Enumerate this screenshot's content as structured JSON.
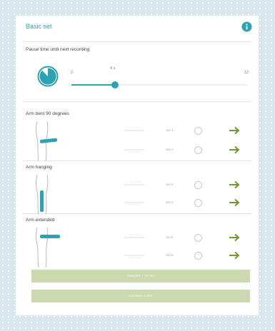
{
  "header": {
    "title": "Basic set"
  },
  "pause": {
    "label": "Pause time until next recording",
    "min_label": "2",
    "value_label": "4 s",
    "max_label": "12",
    "value": 4,
    "min": 2,
    "max": 12
  },
  "sections": [
    {
      "label": "Arm bent 90 degrees",
      "sets": [
        "Set 1",
        "Set 2"
      ]
    },
    {
      "label": "Arm hanging",
      "sets": [
        "Set 3",
        "Set 4"
      ]
    },
    {
      "label": "Arm extended",
      "sets": [
        "Set 5",
        "Set 6"
      ]
    }
  ],
  "buttons": {
    "primary": "Complete 1 Mit Set",
    "secondary": "Complete 6 Sets"
  },
  "colors": {
    "accent": "#2aa3b3",
    "arrow": "#6f9a2b",
    "button": "#ccd8ae"
  },
  "icons": {
    "info": "info-icon",
    "timer": "timer-icon",
    "arrow": "arrow-right-icon"
  }
}
